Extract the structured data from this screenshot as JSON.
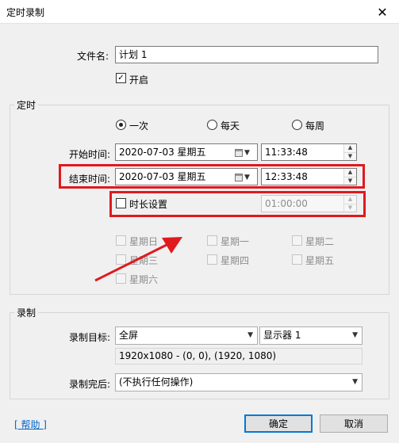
{
  "window": {
    "title": "定时录制",
    "close_glyph": "✕"
  },
  "file": {
    "label": "文件名:",
    "value": "计划 1",
    "enable_label": "开启",
    "enable_checked": true
  },
  "schedule": {
    "group_label": "定时",
    "frequency": {
      "options": [
        "一次",
        "每天",
        "每周"
      ],
      "selected": "一次"
    },
    "start": {
      "label": "开始时间:",
      "date": "2020-07-03 星期五",
      "time": "11:33:48"
    },
    "end": {
      "label": "结束时间:",
      "date": "2020-07-03 星期五",
      "time": "12:33:48"
    },
    "duration": {
      "label": "时长设置",
      "checked": false,
      "value": "01:00:00"
    },
    "weekdays": [
      "星期日",
      "星期一",
      "星期二",
      "星期三",
      "星期四",
      "星期五",
      "星期六"
    ]
  },
  "record": {
    "group_label": "录制",
    "target_label": "录制目标:",
    "target_value": "全屏",
    "monitor_value": "显示器 1",
    "region_text": "1920x1080 - (0, 0), (1920, 1080)",
    "after_label": "录制完后:",
    "after_value": "(不执行任何操作)"
  },
  "footer": {
    "help_label": "[ 帮助 ]",
    "ok_label": "确定",
    "cancel_label": "取消"
  },
  "annotation": {
    "highlight_color": "#e0191e",
    "arrow_color": "#e0191e"
  }
}
